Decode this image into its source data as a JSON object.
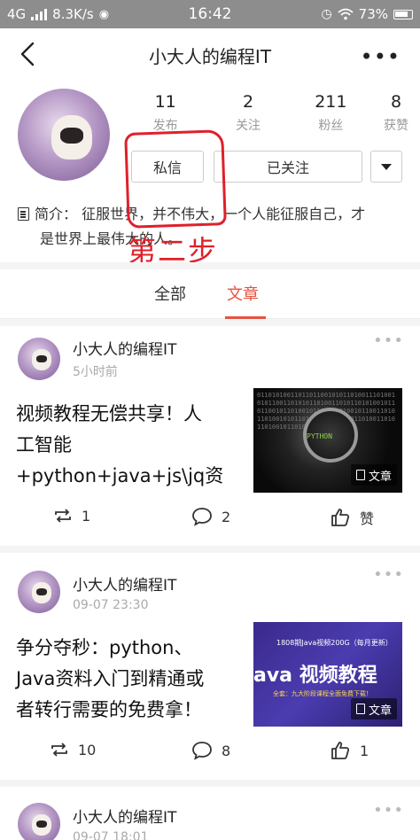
{
  "status_bar": {
    "network": "4G",
    "speed": "8.3K/s",
    "time": "16:42",
    "battery": "73%"
  },
  "nav": {
    "title": "小大人的编程IT",
    "back_icon": "chevron-left-icon",
    "more_icon": "more-horizontal-icon"
  },
  "profile": {
    "stats": [
      {
        "num": "11",
        "label": "发布"
      },
      {
        "num": "2",
        "label": "关注"
      },
      {
        "num": "211",
        "label": "粉丝"
      },
      {
        "num": "8",
        "label": "获赞"
      }
    ],
    "message_button": "私信",
    "follow_button": "已关注",
    "intro_line1": "简介：  征服世界，并不伟大，一个人能征服自己，才",
    "intro_line2": "是世界上最伟大的人。"
  },
  "annotation": {
    "text": "第二步",
    "color": "#e0202a"
  },
  "tabs": [
    {
      "label": "全部",
      "active": false
    },
    {
      "label": "文章",
      "active": true
    }
  ],
  "accent_color": "#e8523f",
  "posts": [
    {
      "author": "小大人的编程IT",
      "time": "5小时前",
      "title_lines": [
        "视频教程无偿共享！人",
        "工智能",
        "+python+java+js\\jq资"
      ],
      "thumb_text": "PYTHON",
      "badge": "文章",
      "reposts": "1",
      "comments": "2",
      "likes": "赞"
    },
    {
      "author": "小大人的编程IT",
      "time": "09-07 23:30",
      "title_lines": [
        "争分夺秒：python、",
        "Java资料入门到精通或",
        "者转行需要的免费拿！"
      ],
      "thumb_text_top": "1808期Java视频200G（每月更新）",
      "thumb_text_main": "ava 视频教程",
      "thumb_text_bottom": "全套：九大阶段课程全面免费下载！",
      "badge": "文章",
      "reposts": "10",
      "comments": "8",
      "likes": "1"
    },
    {
      "author": "小大人的编程IT",
      "time": "09-07 18:01"
    }
  ]
}
